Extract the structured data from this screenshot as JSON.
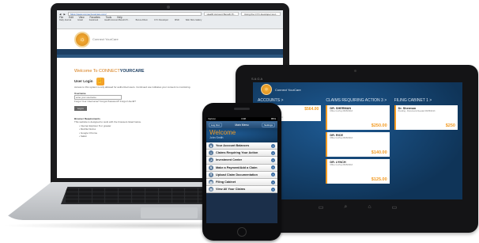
{
  "laptop": {
    "browser": {
      "url": "https://www.connectyourcare.com/",
      "tabs": [
        "Health Account Benefit Pl...",
        "Using the CYC developer tool..."
      ],
      "menu": [
        "File",
        "Edit",
        "View",
        "Favorites",
        "Tools",
        "Help"
      ],
      "favorites": [
        "Daily Journal",
        "Gmail",
        "Facebook",
        "Health Account Benefit Pl...",
        "Bonus Album",
        "CYC Developer",
        "MSD",
        "Web Slice Gallery"
      ]
    },
    "site": {
      "welcome_prefix": "Welcome To CONNECT",
      "welcome_suffix": "YOURCARE",
      "top_button": "Back to top",
      "login_title": "User Login",
      "login_intro": "Access to this system is only allowed for authorized users. Continued use indicates your consent to monitoring.",
      "username_label": "Username",
      "username_value": "enter your username",
      "help_text": "Forgot Your Username? Forgot Password? Forgot UserId?",
      "login_button": "Log In",
      "req_title": "Browser Requirements",
      "req_text": "This website is designed to work with the browsers listed below.",
      "req_items": [
        "Internet Explorer 8 or greater",
        "Mozilla Firefox",
        "Google Chrome",
        "Safari"
      ]
    }
  },
  "tablet": {
    "brand": "SAGA",
    "logo_text": "Connect YourCare",
    "columns": [
      {
        "title": "ACCOUNTS  >",
        "cards": [
          {
            "name": "HSA",
            "sub": "Health Savings Account",
            "amount": "$564.00",
            "amount_pos": "top"
          }
        ]
      },
      {
        "title": "CLAIMS REQUIRING ACTION  3  >",
        "cards": [
          {
            "name": "DR. SHERMAN",
            "sub": "Office Co-Pay 06/05/2013",
            "amount": "$250.00",
            "amount_pos": "bottom"
          },
          {
            "name": "DR. RICE",
            "sub": "Office Co-Pay 06/05/2013",
            "amount": "$140.00",
            "amount_pos": "bottom"
          },
          {
            "name": "DR. LYNCH",
            "sub": "Office Co-Pay 06/05/2013",
            "amount": "$125.00",
            "amount_pos": "bottom"
          }
        ]
      },
      {
        "title": "FILING CABINET  1  >",
        "cards": [
          {
            "name": "Dr. Sherman",
            "sub": "Pending - Documents Needed 06/05/2013",
            "amount": "$250",
            "amount_pos": "bottom"
          }
        ]
      }
    ],
    "nav_glyphs": [
      "▭",
      "⌕",
      "⌂",
      "▭"
    ]
  },
  "phone": {
    "status_left": "Verizon",
    "status_time": "3:38",
    "status_right": "85%",
    "nav_left": "Log Out",
    "nav_title": "Main Menu",
    "nav_right": "Settings",
    "welcome": "Welcome",
    "user": "John Smith",
    "menu": [
      {
        "icon": "$",
        "label": "Your Account Balances"
      },
      {
        "icon": "!",
        "label": "Claims Requiring Your Action"
      },
      {
        "icon": "↗",
        "label": "Investment Center"
      },
      {
        "icon": "$",
        "label": "Make a Payment/Add a Claim"
      },
      {
        "icon": "⇪",
        "label": "Upload Claim Documentation"
      },
      {
        "icon": "▤",
        "label": "Filing Cabinet"
      },
      {
        "icon": "☰",
        "label": "View All Your Claims"
      }
    ]
  }
}
